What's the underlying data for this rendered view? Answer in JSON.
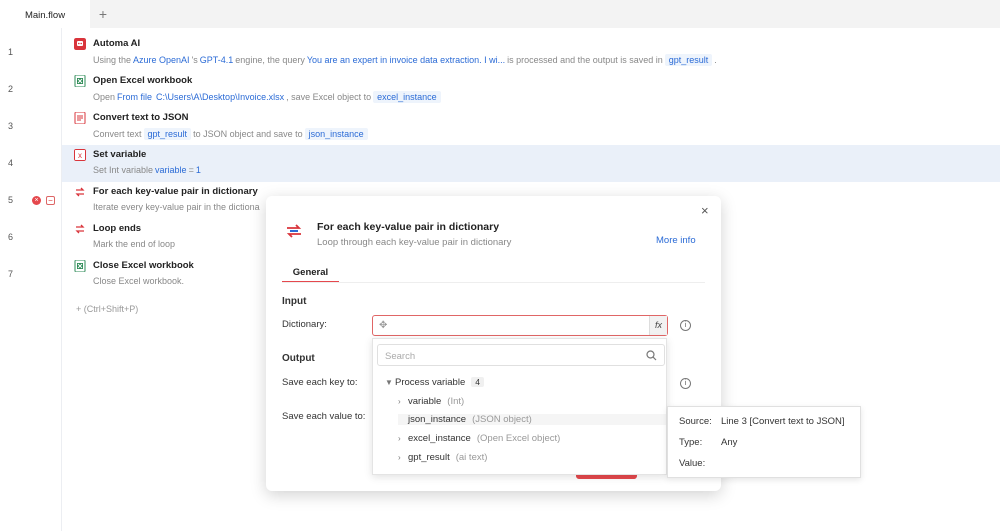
{
  "tabs": [
    {
      "label": "Main.flow"
    }
  ],
  "new_tab": "+",
  "steps": [
    {
      "line": "1",
      "title": "Automa AI",
      "desc_parts": [
        "Using the",
        "Azure OpenAI",
        "'s",
        "GPT-4.1",
        "engine, the query",
        "You are an expert in invoice data extraction. I wi...",
        "is processed and the output is saved in",
        "gpt_result",
        "."
      ]
    },
    {
      "line": "2",
      "title": "Open Excel workbook",
      "desc_parts": [
        "Open",
        "From file",
        "C:\\Users\\A\\Desktop\\Invoice.xlsx",
        ", save Excel object to",
        "excel_instance"
      ]
    },
    {
      "line": "3",
      "title": "Convert text to JSON",
      "desc_parts": [
        "Convert text",
        "gpt_result",
        "to JSON object and save to",
        "json_instance"
      ]
    },
    {
      "line": "4",
      "title": "Set variable",
      "desc_parts": [
        "Set Int variable",
        "variable",
        "=",
        "1"
      ]
    },
    {
      "line": "5",
      "title": "For each key-value pair in dictionary",
      "desc_parts": [
        "Iterate every key-value pair in the dictiona"
      ]
    },
    {
      "line": "6",
      "title": "Loop ends",
      "desc_parts": [
        "Mark the end of loop"
      ]
    },
    {
      "line": "7",
      "title": "Close Excel workbook",
      "desc_parts": [
        "Close Excel workbook."
      ]
    }
  ],
  "add_hint": "+ (Ctrl+Shift+P)",
  "line5_collapse": "−",
  "line5_error": "×",
  "modal": {
    "title": "For each key-value pair in dictionary",
    "subtitle": "Loop through each key-value pair in dictionary",
    "more_info": "More info",
    "close": "×",
    "tab": "General",
    "input_section": "Input",
    "dictionary_label": "Dictionary:",
    "dictionary_value": "",
    "fx": "fx",
    "output_section": "Output",
    "key_label": "Save each key to:",
    "value_label": "Save each value to:"
  },
  "dropdown": {
    "search_placeholder": "Search",
    "group": {
      "label": "Process variable",
      "count": "4"
    },
    "items": [
      {
        "name": "variable",
        "type": "(Int)"
      },
      {
        "name": "json_instance",
        "type": "(JSON object)"
      },
      {
        "name": "excel_instance",
        "type": "(Open Excel object)"
      },
      {
        "name": "gpt_result",
        "type": "(ai text)"
      }
    ]
  },
  "tooltip": {
    "source_key": "Source:",
    "source_val": "Line 3 [Convert text to JSON]",
    "type_key": "Type:",
    "type_val": "Any",
    "value_key": "Value:",
    "value_val": ""
  },
  "colors": {
    "accent": "#2b6bd6",
    "danger": "#e5484d",
    "selected_row": "#eaf0f9"
  },
  "icons": [
    "ai-icon",
    "excel-open-icon",
    "json-convert-icon",
    "set-variable-icon",
    "loop-icon",
    "loop-end-icon",
    "excel-close-icon",
    "search-icon",
    "info-icon",
    "close-icon"
  ]
}
